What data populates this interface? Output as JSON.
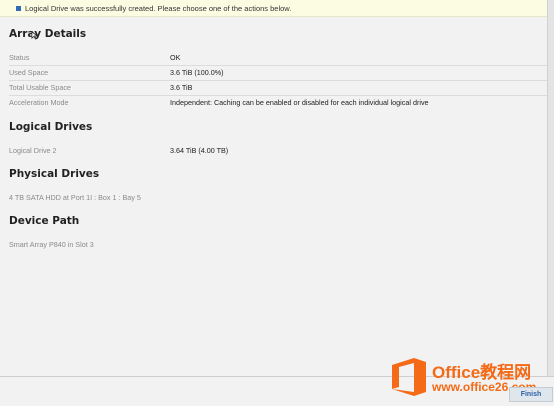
{
  "notice": {
    "message": "Logical Drive was successfully created. Please choose one of the actions below."
  },
  "array_details": {
    "title": "Array Details",
    "rows": [
      {
        "label": "Status",
        "value": "OK"
      },
      {
        "label": "Used Space",
        "value": "3.6 TiB (100.0%)"
      },
      {
        "label": "Total Usable Space",
        "value": "3.6 TiB"
      },
      {
        "label": "Acceleration Mode",
        "value": "Independent: Caching can be enabled or disabled for each individual logical drive"
      }
    ]
  },
  "logical_drives": {
    "title": "Logical Drives",
    "rows": [
      {
        "label": "Logical Drive 2",
        "value": "3.64 TiB (4.00 TB)"
      }
    ]
  },
  "physical_drives": {
    "title": "Physical Drives",
    "items": [
      "4 TB SATA HDD at Port 1I : Box 1 : Bay 5"
    ]
  },
  "device_path": {
    "title": "Device Path",
    "items": [
      "Smart Array P840 in Slot 3"
    ]
  },
  "footer": {
    "finish_label": "Finish"
  },
  "watermark": {
    "title": "Office教程网",
    "url": "www.office26.com"
  },
  "colors": {
    "accent": "#2a62a6",
    "notice_bg": "#fcfce3",
    "watermark": "#f46a16"
  },
  "icons": {
    "notice": "info-square-icon",
    "cursor": "mouse-pointer-icon",
    "watermark_logo": "office-logo-icon"
  }
}
